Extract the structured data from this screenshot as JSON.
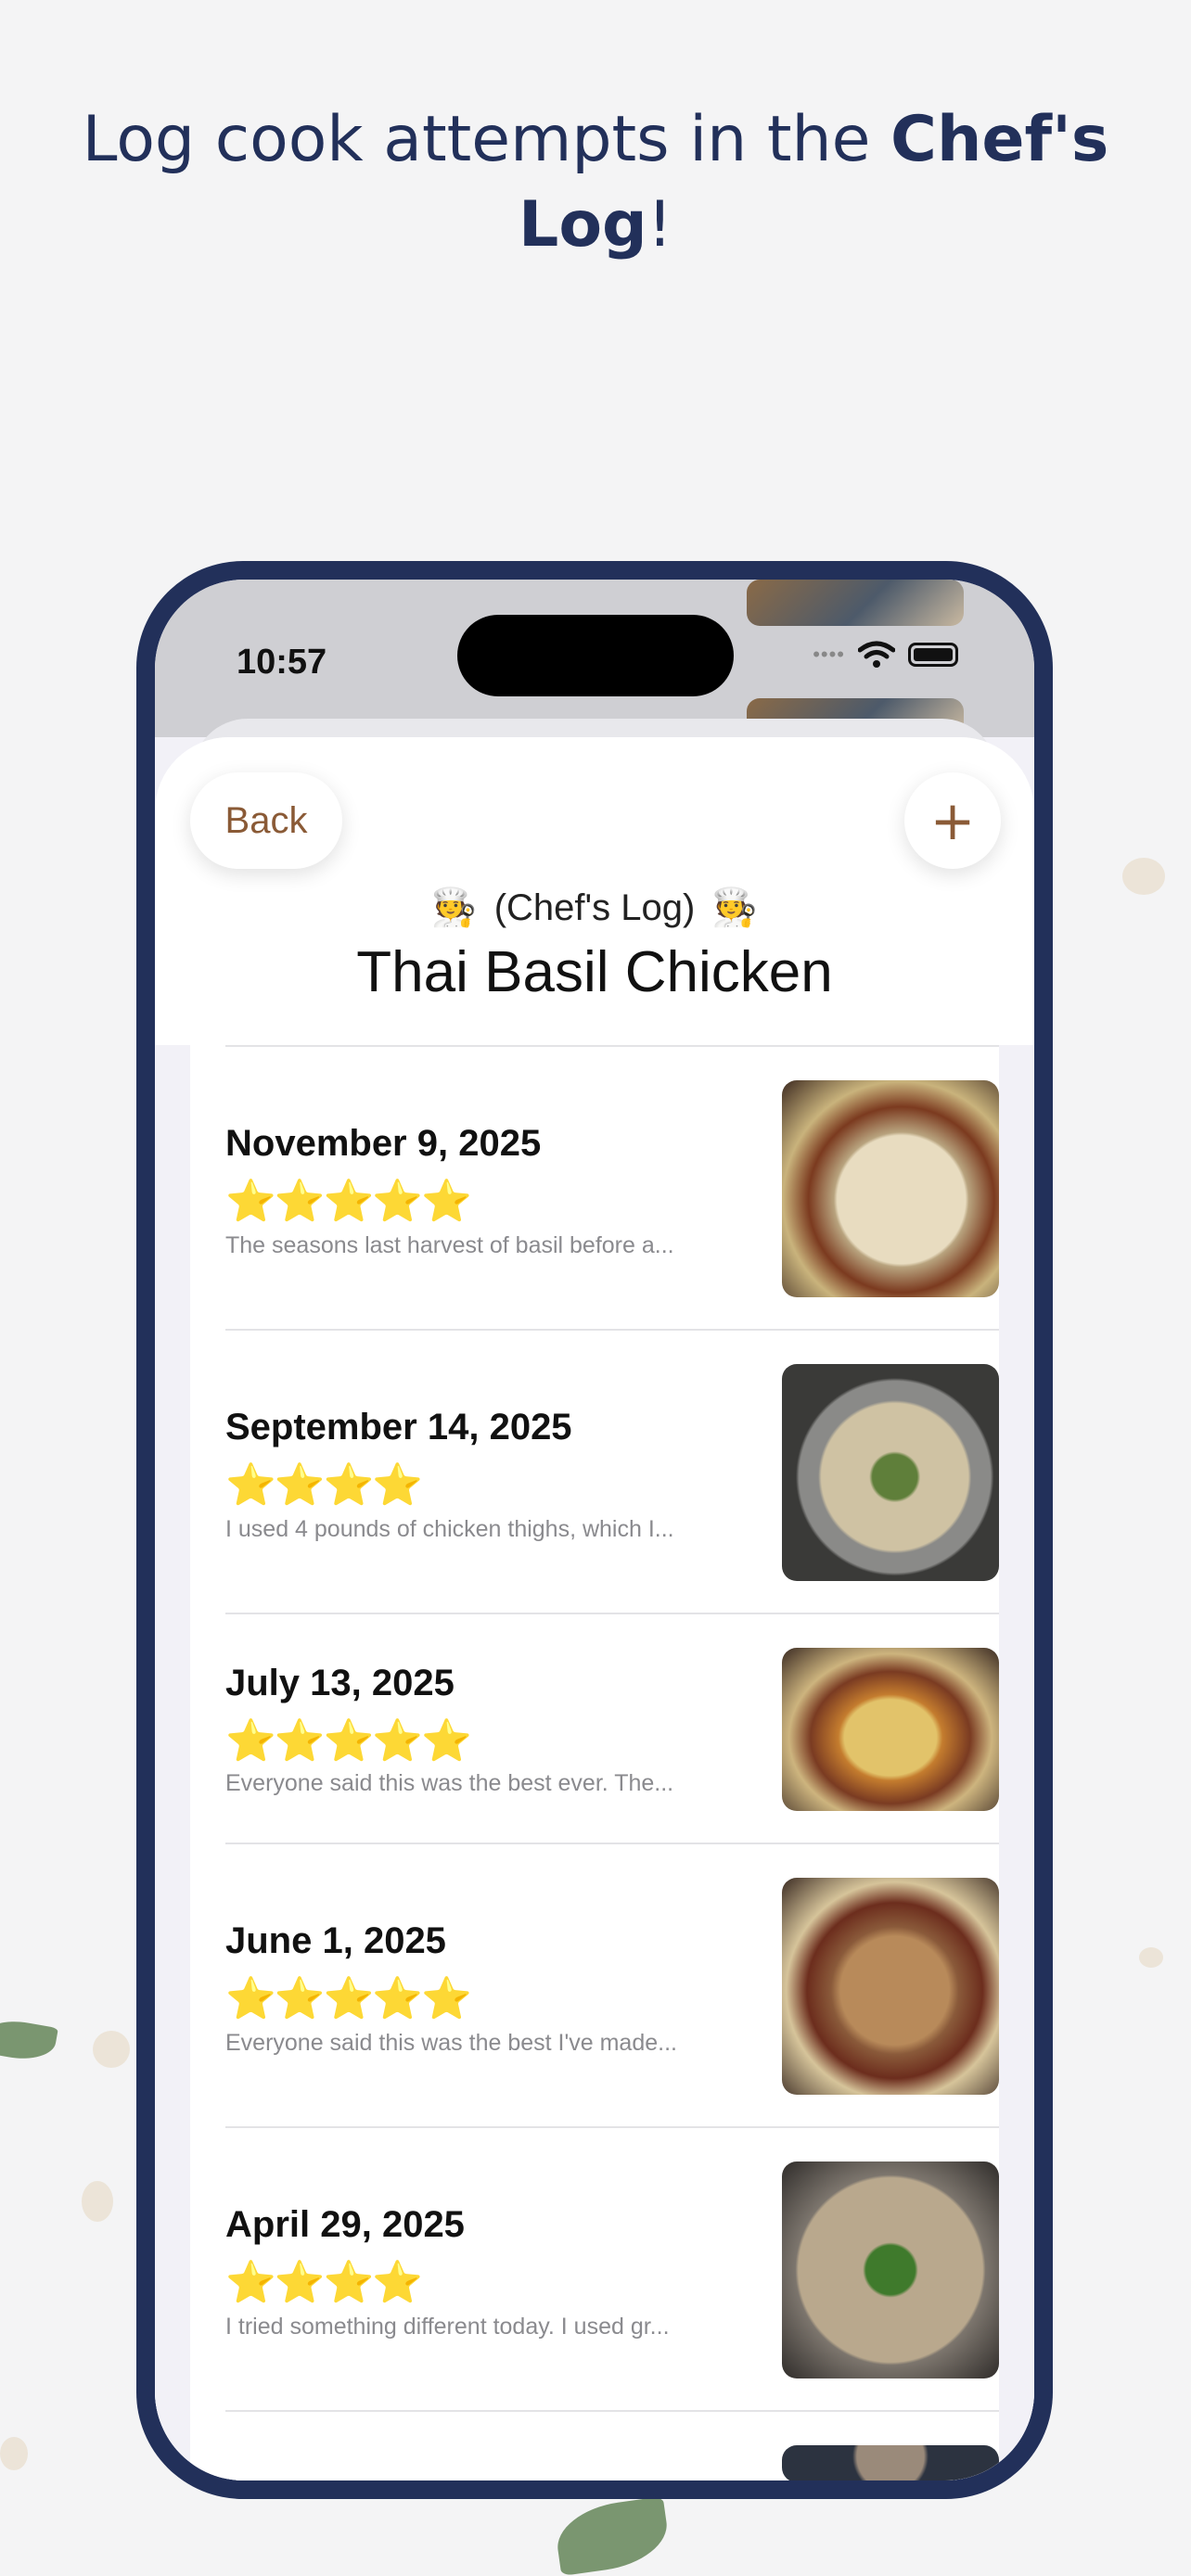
{
  "headline": {
    "prefix": "Log cook attempts in the ",
    "bold": "Chef's Log",
    "suffix": "!"
  },
  "status_bar": {
    "time": "10:57",
    "signal": "••••"
  },
  "header": {
    "back_label": "Back",
    "add_label": "+",
    "subtitle": "(Chef's Log)",
    "chef_emoji": "🧑‍🍳",
    "title": "Thai Basil Chicken"
  },
  "entries": [
    {
      "date": "November 9, 2025",
      "stars": "⭐⭐⭐⭐⭐",
      "rating": 5,
      "note": "The seasons last harvest of basil before a..."
    },
    {
      "date": "September 14, 2025",
      "stars": "⭐⭐⭐⭐",
      "rating": 4,
      "note": "I used 4 pounds of chicken thighs, which I..."
    },
    {
      "date": "July 13, 2025",
      "stars": "⭐⭐⭐⭐⭐",
      "rating": 5,
      "note": "Everyone said this was the best ever. The..."
    },
    {
      "date": "June 1, 2025",
      "stars": "⭐⭐⭐⭐⭐",
      "rating": 5,
      "note": "Everyone said this was the best I've made..."
    },
    {
      "date": "April 29, 2025",
      "stars": "⭐⭐⭐⭐",
      "rating": 4,
      "note": "I tried something different today. I used gr..."
    }
  ],
  "colors": {
    "brand_navy": "#22305a",
    "accent_brown": "#8a5a36",
    "star": "#f3b400"
  }
}
